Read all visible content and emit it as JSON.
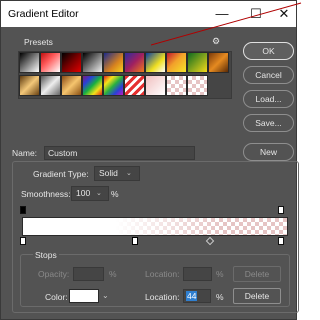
{
  "window": {
    "title": "Gradient Editor",
    "minimize_icon": "minimize-icon",
    "maximize_icon": "maximize-icon",
    "close_icon": "close-icon"
  },
  "presets": {
    "label": "Presets",
    "gear_icon": "gear-icon",
    "swatches": [
      {
        "bg": "linear-gradient(135deg,#000 0%,#fff 100%)"
      },
      {
        "bg": "linear-gradient(135deg,#c01010 0%,#ff5b5b 40%,#ffffff 100%)"
      },
      {
        "bg": "linear-gradient(135deg,#000 0%,#7a0000 50%,#e00000 100%)"
      },
      {
        "bg": "linear-gradient(135deg,#000 0%,#f0f0f0 100%)"
      },
      {
        "bg": "linear-gradient(135deg,#1b2b8c 0%,#d8821e 60%,#f5d020 100%)"
      },
      {
        "bg": "linear-gradient(135deg,#2d2c9e 0%,#a02060 50%,#f07a1a 100%)"
      },
      {
        "bg": "linear-gradient(135deg,#0a3ea0 0%,#f0e020 60%,#ffffff 100%)"
      },
      {
        "bg": "linear-gradient(135deg,#c2182c 0%,#f2a12a 45%,#f5e52a 100%)"
      },
      {
        "bg": "linear-gradient(135deg,#0e6a20 0%,#f3da1b 100%)"
      },
      {
        "bg": "linear-gradient(135deg,#7b3a0a 0%,#e58a20 50%,#5a2a06 100%)"
      },
      {
        "bg": "linear-gradient(135deg,#5e3a0e 0%,#f3c87a 50%,#6a4212 100%)"
      },
      {
        "bg": "linear-gradient(135deg,#555 0%,#eee 50%,#666 100%)"
      },
      {
        "bg": "linear-gradient(135deg,#8a4a14 0%,#f6c56e 50%,#8a5012 100%)"
      },
      {
        "bg": "linear-gradient(135deg,#7c1c7c 0%,#2a40d8 25%,#18b040 50%,#f2e21a 75%,#e2231a 100%)"
      },
      {
        "bg": "linear-gradient(135deg,#e2231a 0%,#f6e21a 25%,#2ab040 50%,#2a40d8 75%,#c01cc0 100%)"
      },
      {
        "bg": "repeating-linear-gradient(135deg,#e53030 0px,#e53030 3px,#ffffff 3px,#ffffff 6px)"
      },
      {
        "bg": "linear-gradient(135deg,#f0c0c0 0%,#ffffff 100%)"
      },
      {
        "bg": "checker"
      },
      {
        "bg": "checker"
      }
    ]
  },
  "buttons": {
    "ok": "OK",
    "cancel": "Cancel",
    "load": "Load...",
    "save": "Save...",
    "new": "New",
    "delete_opacity": "Delete",
    "delete_color": "Delete"
  },
  "name": {
    "label": "Name:",
    "value": "Custom"
  },
  "gradient_type": {
    "label": "Gradient Type:",
    "value": "Solid"
  },
  "smoothness": {
    "label": "Smoothness:",
    "value": "100",
    "unit": "%"
  },
  "stops": {
    "label": "Stops",
    "opacity_label": "Opacity:",
    "opacity_value": "",
    "opacity_unit": "%",
    "opacity_location_label": "Location:",
    "opacity_location_value": "",
    "opacity_location_unit": "%",
    "color_label": "Color:",
    "color_value": "#ffffff",
    "color_location_label": "Location:",
    "color_location_value": "44",
    "color_location_unit": "%"
  },
  "colors": {
    "window_bg": "#535353",
    "field_bg": "#454545",
    "highlight": "#2f7fd0",
    "annotation_line": "#b00000"
  }
}
